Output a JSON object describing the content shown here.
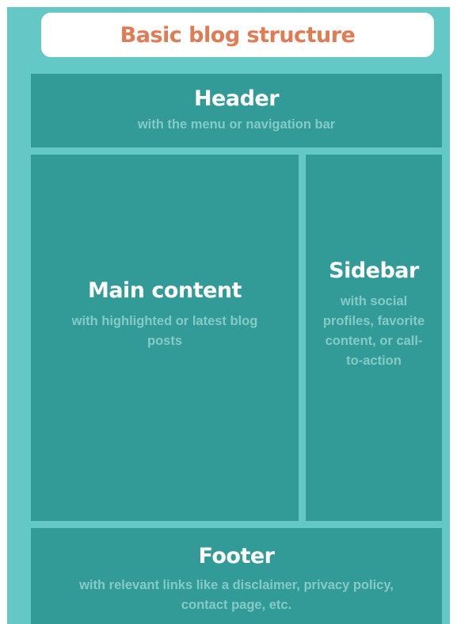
{
  "title": "Basic blog structure",
  "blocks": {
    "header": {
      "title": "Header",
      "description": "with the menu or navigation bar"
    },
    "main_content": {
      "title": "Main content",
      "description": "with highlighted or latest blog posts"
    },
    "sidebar": {
      "title": "Sidebar",
      "description": "with social profiles, favorite content, or call-to-action"
    },
    "footer": {
      "title": "Footer",
      "description": "with relevant links like a disclaimer, privacy policy, contact page, etc."
    }
  },
  "colors": {
    "background": "#63c8c6",
    "block": "#339b97",
    "title_text": "#e07b54",
    "block_title": "#ffffff",
    "block_description": "#84cac6"
  }
}
